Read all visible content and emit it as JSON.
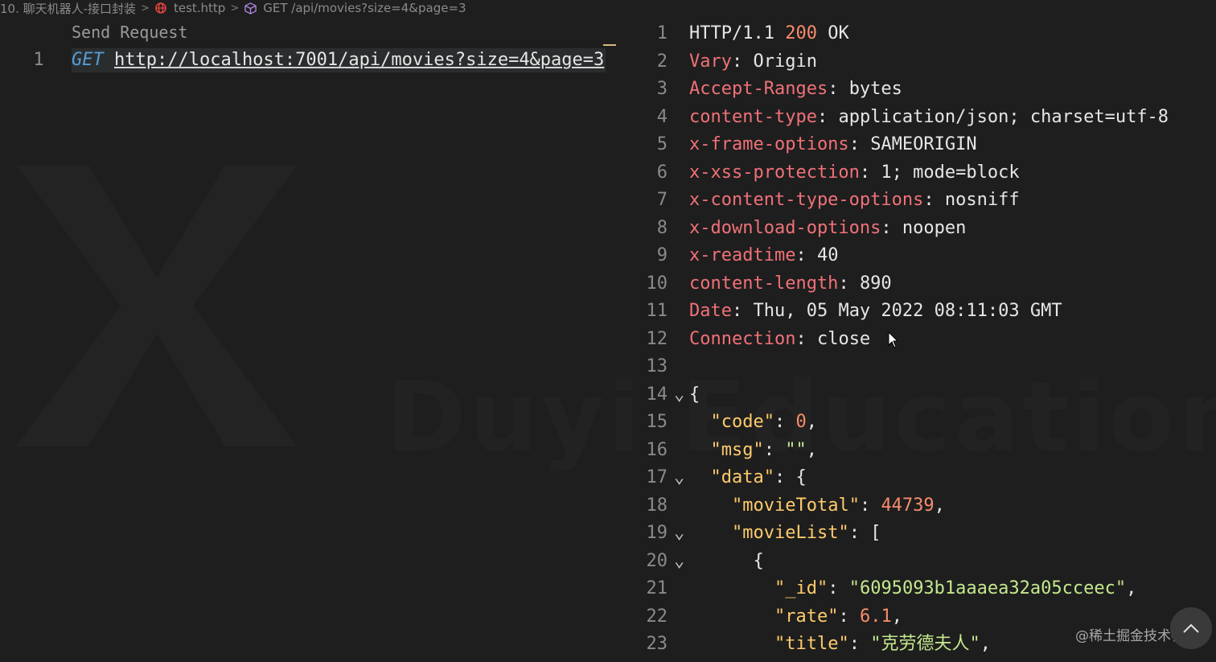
{
  "breadcrumb": {
    "folder": "10. 聊天机器人-接口封装",
    "file": "test.http",
    "request": "GET /api/movies?size=4&page=3"
  },
  "editor": {
    "codelens": "Send Request",
    "line_number": "1",
    "method": "GET",
    "url": "http://localhost:7001/api/movies?size=4&page=3"
  },
  "response": {
    "status_line": {
      "proto": "HTTP/1.1",
      "code": "200",
      "text": "OK"
    },
    "headers": [
      {
        "name": "Vary",
        "value": "Origin"
      },
      {
        "name": "Accept-Ranges",
        "value": "bytes"
      },
      {
        "name": "content-type",
        "value": "application/json; charset=utf-8"
      },
      {
        "name": "x-frame-options",
        "value": "SAMEORIGIN"
      },
      {
        "name": "x-xss-protection",
        "value": "1; mode=block"
      },
      {
        "name": "x-content-type-options",
        "value": "nosniff"
      },
      {
        "name": "x-download-options",
        "value": "noopen"
      },
      {
        "name": "x-readtime",
        "value": "40"
      },
      {
        "name": "content-length",
        "value": "890"
      },
      {
        "name": "Date",
        "value": "Thu, 05 May 2022 08:11:03 GMT"
      },
      {
        "name": "Connection",
        "value": "close"
      }
    ],
    "body": {
      "code_key": "code",
      "code_val": "0",
      "msg_key": "msg",
      "msg_val": "\"\"",
      "data_key": "data",
      "movieTotal_key": "movieTotal",
      "movieTotal_val": "44739",
      "movieList_key": "movieList",
      "id_key": "_id",
      "id_val": "\"6095093b1aaaea32a05cceec\"",
      "rate_key": "rate",
      "rate_val": "6.1",
      "title_key": "title",
      "title_val": "\"克劳德夫人\""
    }
  },
  "watermark": "Duyi Education",
  "credit": "@稀土掘金技术社区"
}
